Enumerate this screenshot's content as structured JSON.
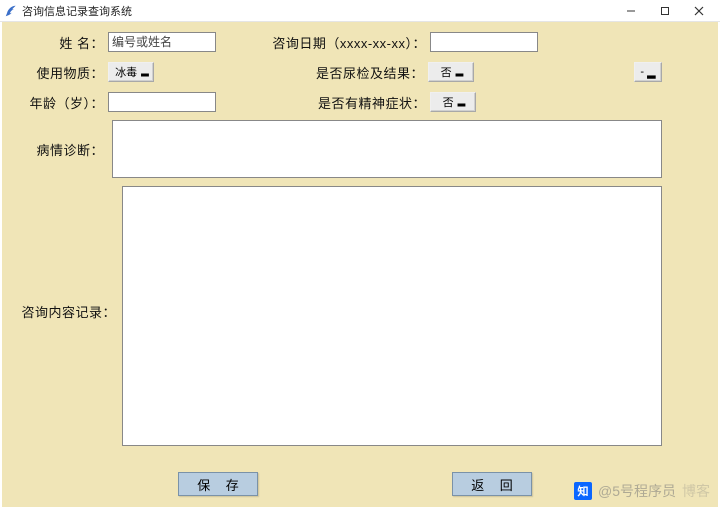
{
  "window": {
    "title": "咨询信息记录查询系统",
    "min_tip": "Minimize",
    "max_tip": "Maximize",
    "close_tip": "Close"
  },
  "form": {
    "name_label": "姓 名：",
    "name_placeholder": "编号或姓名",
    "name_value": "",
    "date_label": "咨询日期（xxxx-xx-xx）：",
    "date_value": "",
    "substance_label": "使用物质：",
    "substance_value": "冰毒",
    "urine_label": "是否尿检及结果：",
    "urine_value": "否",
    "extra_value": "-",
    "age_label": "年龄（岁）：",
    "age_value": "",
    "mental_label": "是否有精神症状：",
    "mental_value": "否",
    "diagnosis_label": "病情诊断：",
    "diagnosis_value": "",
    "record_label": "咨询内容记录：",
    "record_value": ""
  },
  "actions": {
    "save": "保 存",
    "back": "返 回"
  },
  "watermark": {
    "zhihu": "知",
    "author": "@5号程序员",
    "site": "博客"
  }
}
